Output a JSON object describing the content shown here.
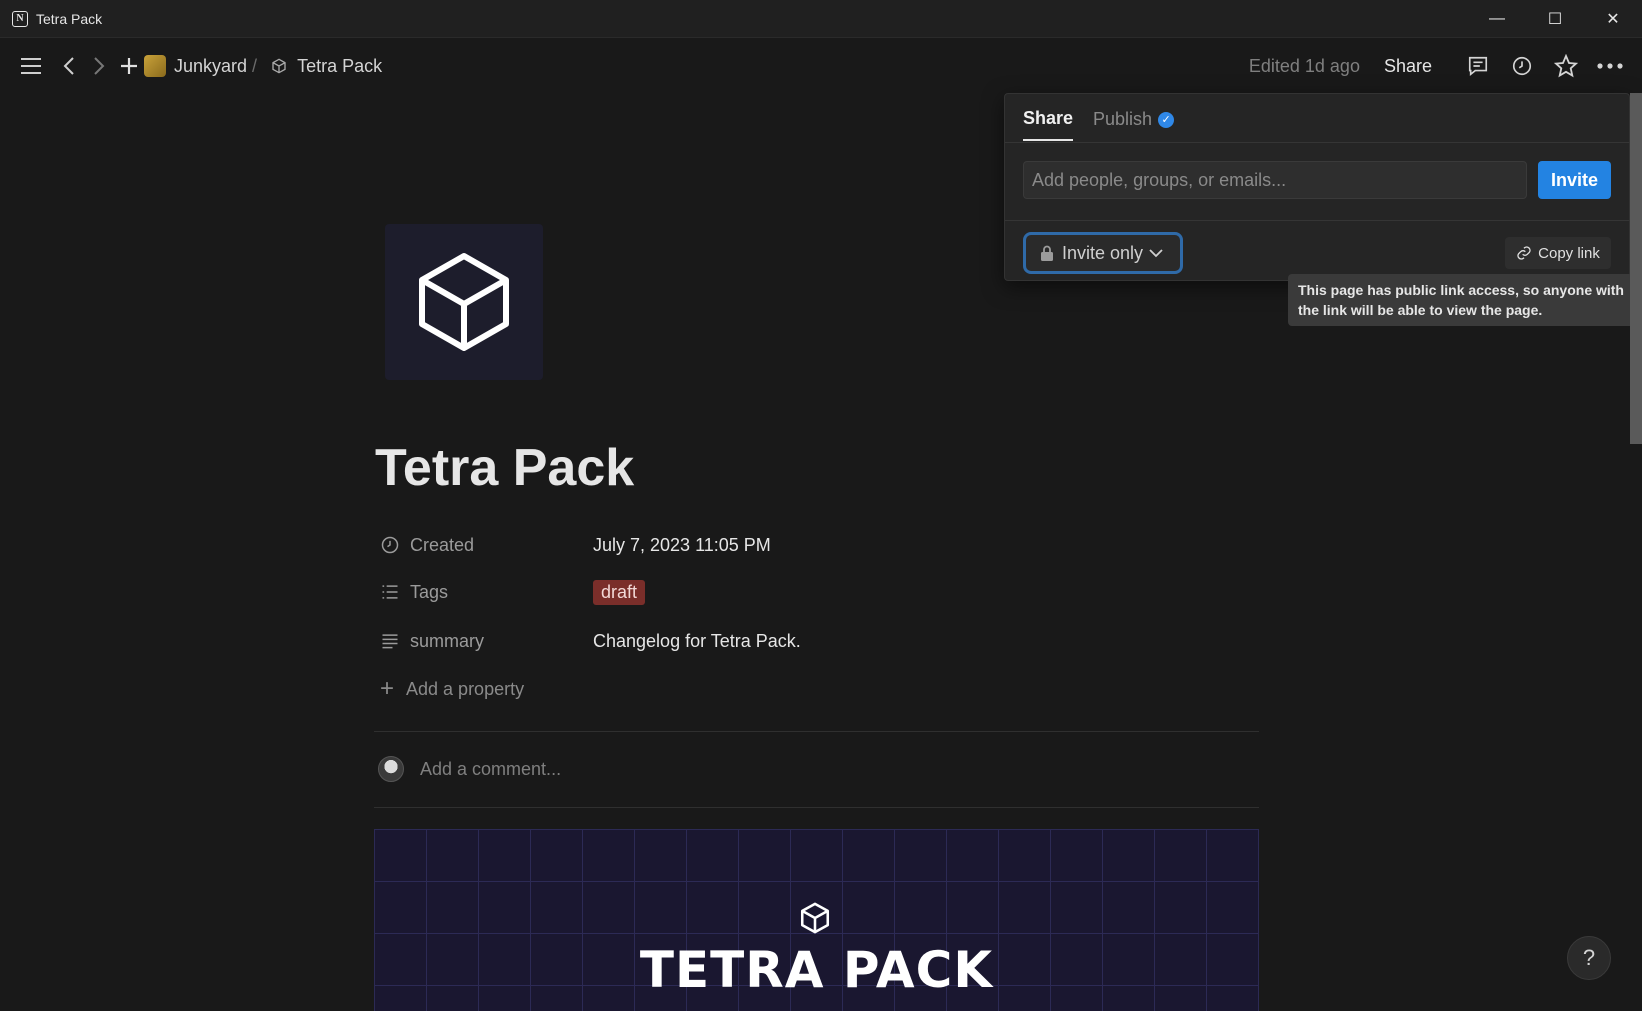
{
  "window": {
    "title": "Tetra Pack",
    "app_icon": "N"
  },
  "window_controls": {
    "minimize": "—",
    "maximize": "☐",
    "close": "✕"
  },
  "breadcrumb": {
    "workspace": "Junkyard",
    "separator": "/",
    "page": "Tetra Pack"
  },
  "topbar": {
    "edited": "Edited 1d ago",
    "share_label": "Share"
  },
  "page": {
    "title": "Tetra Pack",
    "properties": [
      {
        "label": "Created",
        "value": "July 7, 2023 11:05 PM",
        "icon": "clock-icon"
      },
      {
        "label": "Tags",
        "value": "draft",
        "icon": "list-icon"
      },
      {
        "label": "summary",
        "value": "Changelog for Tetra Pack.",
        "icon": "text-lines-icon"
      }
    ],
    "add_property": "Add a property",
    "comment_placeholder": "Add a comment...",
    "banner_text": "TETRA PACK",
    "tag_color": "#7a2e2a"
  },
  "share_popover": {
    "tabs": [
      {
        "label": "Share",
        "active": true
      },
      {
        "label": "Publish",
        "active": false
      }
    ],
    "input_placeholder": "Add people, groups, or emails...",
    "invite_label": "Invite",
    "access_label": "Invite only",
    "copy_link_label": "Copy link",
    "accent_color": "#2383e2"
  },
  "tooltip": {
    "text": "This page has public link access, so anyone with the link will be able to view the page."
  },
  "help": {
    "label": "?"
  }
}
